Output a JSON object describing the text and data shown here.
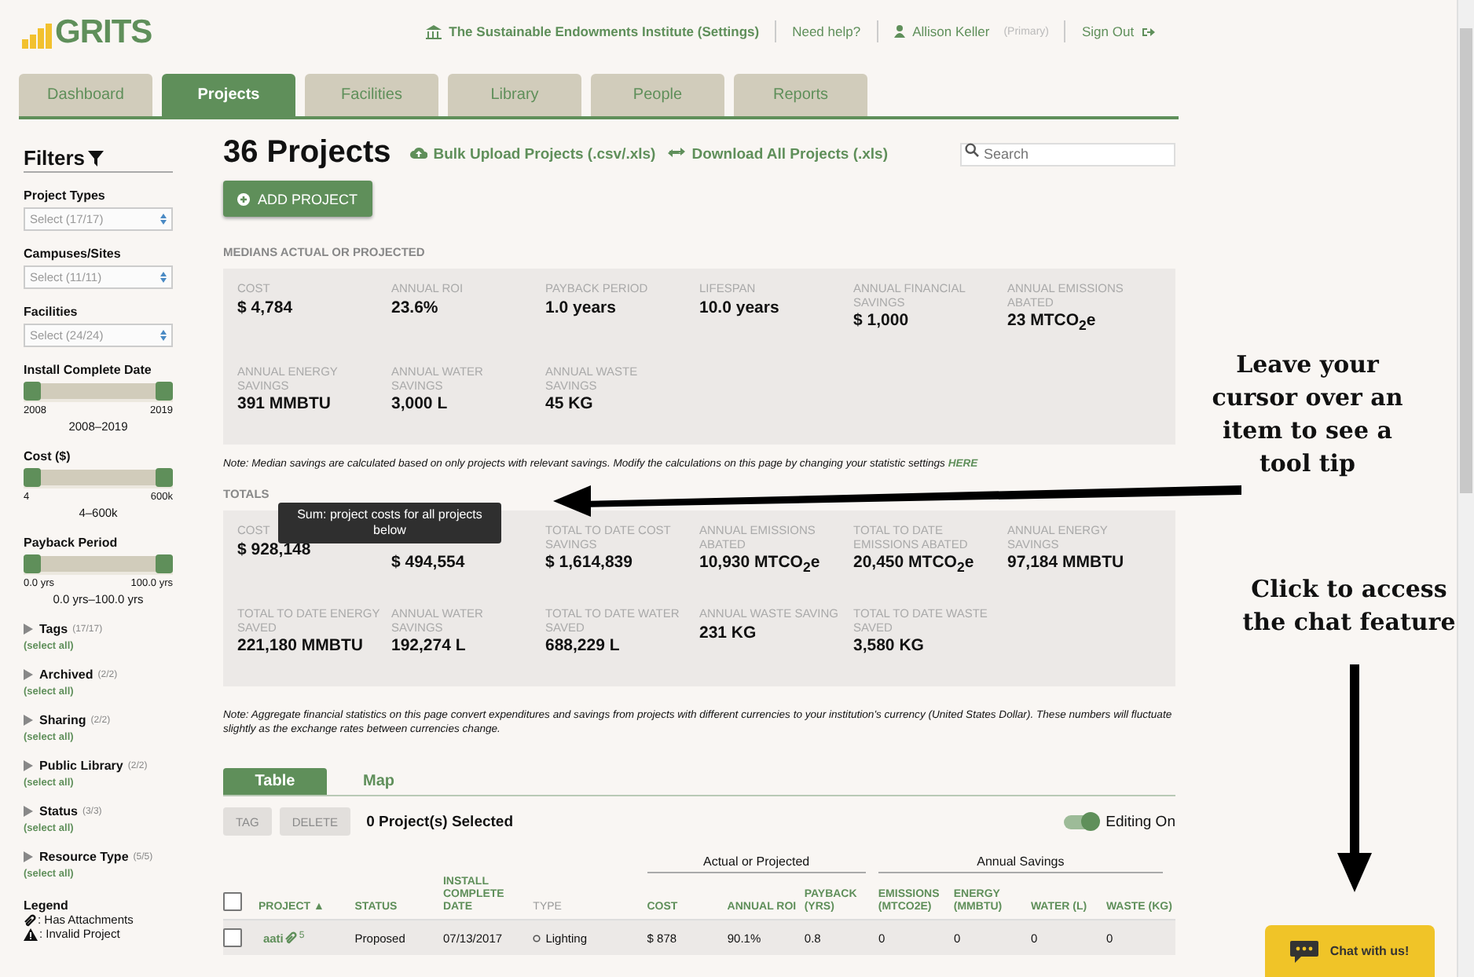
{
  "logo": {
    "text": "GRITS"
  },
  "top_nav": {
    "institution": "The Sustainable Endowments Institute (Settings)",
    "help": "Need help?",
    "user": "Allison Keller",
    "user_role": "(Primary)",
    "sign_out": "Sign Out"
  },
  "tabs": [
    {
      "label": "Dashboard",
      "selected": false
    },
    {
      "label": "Projects",
      "selected": true
    },
    {
      "label": "Facilities",
      "selected": false
    },
    {
      "label": "Library",
      "selected": false
    },
    {
      "label": "People",
      "selected": false
    },
    {
      "label": "Reports",
      "selected": false
    }
  ],
  "filters": {
    "title": "Filters",
    "selects": [
      {
        "label": "Project Types",
        "placeholder": "Select (17/17)"
      },
      {
        "label": "Campuses/Sites",
        "placeholder": "Select (11/11)"
      },
      {
        "label": "Facilities",
        "placeholder": "Select (24/24)"
      }
    ],
    "ranges": [
      {
        "label": "Install Complete Date",
        "level": 1,
        "min": "2008",
        "max": "2019",
        "range": "2008–2019"
      },
      {
        "label": "Cost ($)",
        "level": 1,
        "min": "4",
        "max": "600k",
        "range": "4–600k"
      },
      {
        "label": "Payback Period",
        "level": 1,
        "min": "0.0 yrs",
        "max": "100.0 yrs",
        "range": "0.0 yrs–100.0 yrs"
      }
    ],
    "groups": [
      {
        "label": "Tags",
        "count": "(17/17)",
        "action": "(select all)",
        "expanded": false
      },
      {
        "label": "Archived",
        "count": "(2/2)",
        "action": "(select all)",
        "expanded": false
      },
      {
        "label": "Sharing",
        "count": "(2/2)",
        "action": "(select all)",
        "expanded": false
      },
      {
        "label": "Public Library",
        "count": "(2/2)",
        "action": "(select all)",
        "expanded": false
      },
      {
        "label": "Status",
        "count": "(3/3)",
        "action": "(select all)",
        "expanded": false
      },
      {
        "label": "Resource Type",
        "count": "(5/5)",
        "action": "(select all)",
        "expanded": false
      }
    ],
    "legend": {
      "title": "Legend",
      "items": [
        {
          "kind": "attachment",
          "text": ": Has Attachments"
        },
        {
          "kind": "invalid",
          "text": ": Invalid Project"
        }
      ]
    }
  },
  "page_title": "36 Projects",
  "actions": [
    {
      "kind": "upload",
      "label": "Bulk Upload Projects (.csv/.xls)"
    },
    {
      "kind": "download",
      "label": "Download All Projects (.xls)"
    }
  ],
  "search": {
    "placeholder": "Search"
  },
  "add_button": "ADD PROJECT",
  "medians": {
    "heading": "MEDIANS ACTUAL OR PROJECTED",
    "stats": [
      {
        "label": "COST",
        "value": "$ 4,784"
      },
      {
        "label": "ANNUAL ROI",
        "value": "23.6%"
      },
      {
        "label": "PAYBACK PERIOD",
        "value": "1.0 years"
      },
      {
        "label": "LIFESPAN",
        "value": "10.0 years"
      },
      {
        "label": "ANNUAL FINANCIAL SAVINGS",
        "value": "$ 1,000"
      },
      {
        "label": "ANNUAL EMISSIONS ABATED",
        "value": "23 MTCO$_{2}$e"
      },
      {
        "label": "ANNUAL ENERGY SAVINGS",
        "value": "391 MMBTU"
      },
      {
        "label": "ANNUAL WATER SAVINGS",
        "value": "3,000 L"
      },
      {
        "label": "ANNUAL WASTE SAVINGS",
        "value": "45 KG"
      }
    ]
  },
  "median_note": {
    "text": "Note: Median savings are calculated based on only projects with relevant savings. Modify the calculations on this page by changing your statistic settings",
    "link": "HERE"
  },
  "totals": {
    "heading": "TOTALS",
    "tooltip": "Sum: project costs for all projects below",
    "stats": [
      {
        "label": "COST",
        "value": "$ 928,148"
      },
      {
        "value": "$ 494,554"
      },
      {
        "label": "TOTAL TO DATE COST SAVINGS",
        "value": "$ 1,614,839"
      },
      {
        "label": "ANNUAL EMISSIONS ABATED",
        "value": "10,930 MTCO$_{2}$e"
      },
      {
        "label": "TOTAL TO DATE EMISSIONS ABATED",
        "value": "20,450 MTCO$_{2}$e"
      },
      {
        "label": "ANNUAL ENERGY SAVINGS",
        "value": "97,184 MMBTU"
      },
      {
        "label": "TOTAL TO DATE ENERGY SAVED",
        "value": "221,180 MMBTU"
      },
      {
        "label": "ANNUAL WATER SAVINGS",
        "value": "192,274 L"
      },
      {
        "label": "TOTAL TO DATE WATER SAVED",
        "value": "688,229 L"
      },
      {
        "label": "ANNUAL WASTE SAVING",
        "value": "231 KG"
      },
      {
        "label": "TOTAL TO DATE WASTE SAVED",
        "value": "3,580 KG"
      }
    ]
  },
  "aggregate_note": "Note: Aggregate financial statistics on this page convert expenditures and savings from projects with different currencies to your institution's currency (United States Dollar). These numbers will fluctuate slightly as the exchange rates between currencies change.",
  "view_tabs": [
    {
      "label": "Table",
      "selected": true
    },
    {
      "label": "Map",
      "selected": false
    }
  ],
  "toolbar": {
    "buttons": [
      {
        "label": "TAG",
        "disabled": true
      },
      {
        "label": "DELETE",
        "disabled": true
      }
    ],
    "selected_count": "0 Project(s) Selected",
    "editing": {
      "label": "Editing On",
      "on": true
    }
  },
  "table": {
    "select_all_checked": false,
    "groups": [
      {
        "label": "Actual or Projected"
      },
      {
        "label": "Annual Savings"
      }
    ],
    "columns": [
      {
        "label": "PROJECT ▲",
        "sortable": true
      },
      {
        "label": "STATUS",
        "sortable": true
      },
      {
        "label": "INSTALL COMPLETE DATE",
        "sortable": true
      },
      {
        "label": "TYPE",
        "sortable": false
      },
      {
        "label": "COST",
        "sortable": true
      },
      {
        "label": "ANNUAL ROI",
        "sortable": true
      },
      {
        "label": "PAYBACK (YRS)",
        "sortable": true
      },
      {
        "label": "EMISSIONS (MTCO2E)",
        "sortable": true
      },
      {
        "label": "ENERGY (MMBTU)",
        "sortable": true
      },
      {
        "label": "WATER (L)",
        "sortable": true
      },
      {
        "label": "WASTE (KG)",
        "sortable": true
      }
    ],
    "rows": [
      {
        "selected": false,
        "project": "aati",
        "has_attachment": true,
        "attachment_count": "5",
        "status": "Proposed",
        "date": "07/13/2017",
        "type": "Lighting",
        "cost": "$ 878",
        "roi": "90.1%",
        "payback": "0.8",
        "emissions": "0",
        "energy": "0",
        "water": "0",
        "waste": "0"
      }
    ]
  },
  "annotations": [
    {
      "kind": "tooltip-hint",
      "text": "Leave your cursor over an item to see a tool tip"
    },
    {
      "kind": "chat-hint",
      "text": "Click to access the chat feature"
    }
  ],
  "chat_button": "Chat with us!"
}
